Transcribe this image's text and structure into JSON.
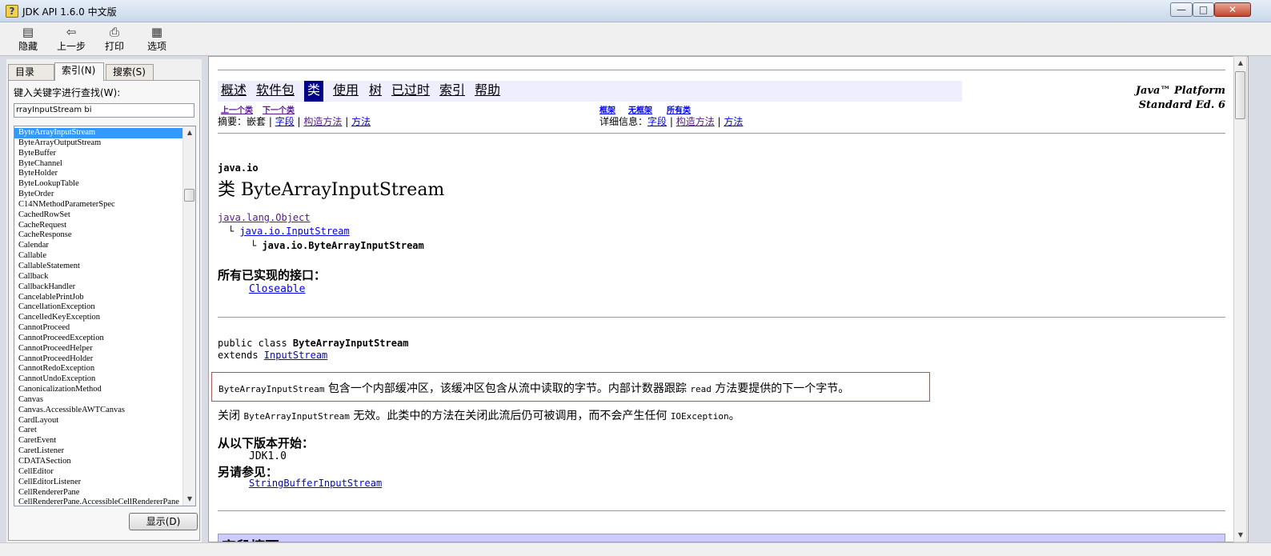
{
  "window": {
    "title": "JDK API 1.6.0 中文版",
    "min_icon": "minimize-icon",
    "max_icon": "maximize-icon",
    "close_icon": "close-icon"
  },
  "toolbar": {
    "hide_label": "隐藏",
    "back_label": "上一步",
    "print_label": "打印",
    "options_label": "选项"
  },
  "left": {
    "tabs": [
      "目录(C)",
      "索引(N)",
      "搜索(S)"
    ],
    "keyword_label": "键入关键字进行查找(W):",
    "keyword_value": "rrayInputStream bi",
    "items": [
      "ByteArrayInputStream",
      "ByteArrayOutputStream",
      "ByteBuffer",
      "ByteChannel",
      "ByteHolder",
      "ByteLookupTable",
      "ByteOrder",
      "C14NMethodParameterSpec",
      "CachedRowSet",
      "CacheRequest",
      "CacheResponse",
      "Calendar",
      "Callable",
      "CallableStatement",
      "Callback",
      "CallbackHandler",
      "CancelablePrintJob",
      "CancellationException",
      "CancelledKeyException",
      "CannotProceed",
      "CannotProceedException",
      "CannotProceedHelper",
      "CannotProceedHolder",
      "CannotRedoException",
      "CannotUndoException",
      "CanonicalizationMethod",
      "Canvas",
      "Canvas.AccessibleAWTCanvas",
      "CardLayout",
      "Caret",
      "CaretEvent",
      "CaretListener",
      "CDATASection",
      "CellEditor",
      "CellEditorListener",
      "CellRendererPane",
      "CellRendererPane.AccessibleCellRendererPane"
    ],
    "show_label": "显示(D)"
  },
  "content": {
    "nav": [
      "概述",
      "软件包",
      "类",
      "使用",
      "树",
      "已过时",
      "索引",
      "帮助"
    ],
    "platform_line1": "Java™ Platform",
    "platform_line2": "Standard Ed. 6",
    "prev_class": "上一个类",
    "next_class": "下一个类",
    "frames": "框架",
    "no_frames": "无框架",
    "all_classes": "所有类",
    "summary_label": "摘要：",
    "summary_nested": "嵌套",
    "detail_label": "详细信息：",
    "field": "字段",
    "constructor": "构造方法",
    "method": "方法",
    "package": "java.io",
    "class_title": "类 ByteArrayInputStream",
    "tree_object": "java.lang.Object",
    "tree_inputstream": "java.io.InputStream",
    "tree_self": "java.io.ByteArrayInputStream",
    "interfaces_heading": "所有已实现的接口：",
    "interface_closeable": "Closeable",
    "decl_public": "public class ",
    "decl_name": "ByteArrayInputStream",
    "decl_extends": "extends ",
    "decl_parent": "InputStream",
    "desc1_a": "ByteArrayInputStream",
    "desc1_b": " 包含一个内部缓冲区，该缓冲区包含从流中读取的字节。内部计数器跟踪 ",
    "desc1_c": "read",
    "desc1_d": " 方法要提供的下一个字节。",
    "desc2_a": "关闭 ",
    "desc2_b": "ByteArrayInputStream",
    "desc2_c": " 无效。此类中的方法在关闭此流后仍可被调用，而不会产生任何 ",
    "desc2_d": "IOException",
    "desc2_e": "。",
    "since_heading": "从以下版本开始：",
    "since_value": "JDK1.0",
    "see_heading": "另请参见：",
    "see_value": "StringBufferInputStream",
    "field_summary": "字段摘要"
  }
}
